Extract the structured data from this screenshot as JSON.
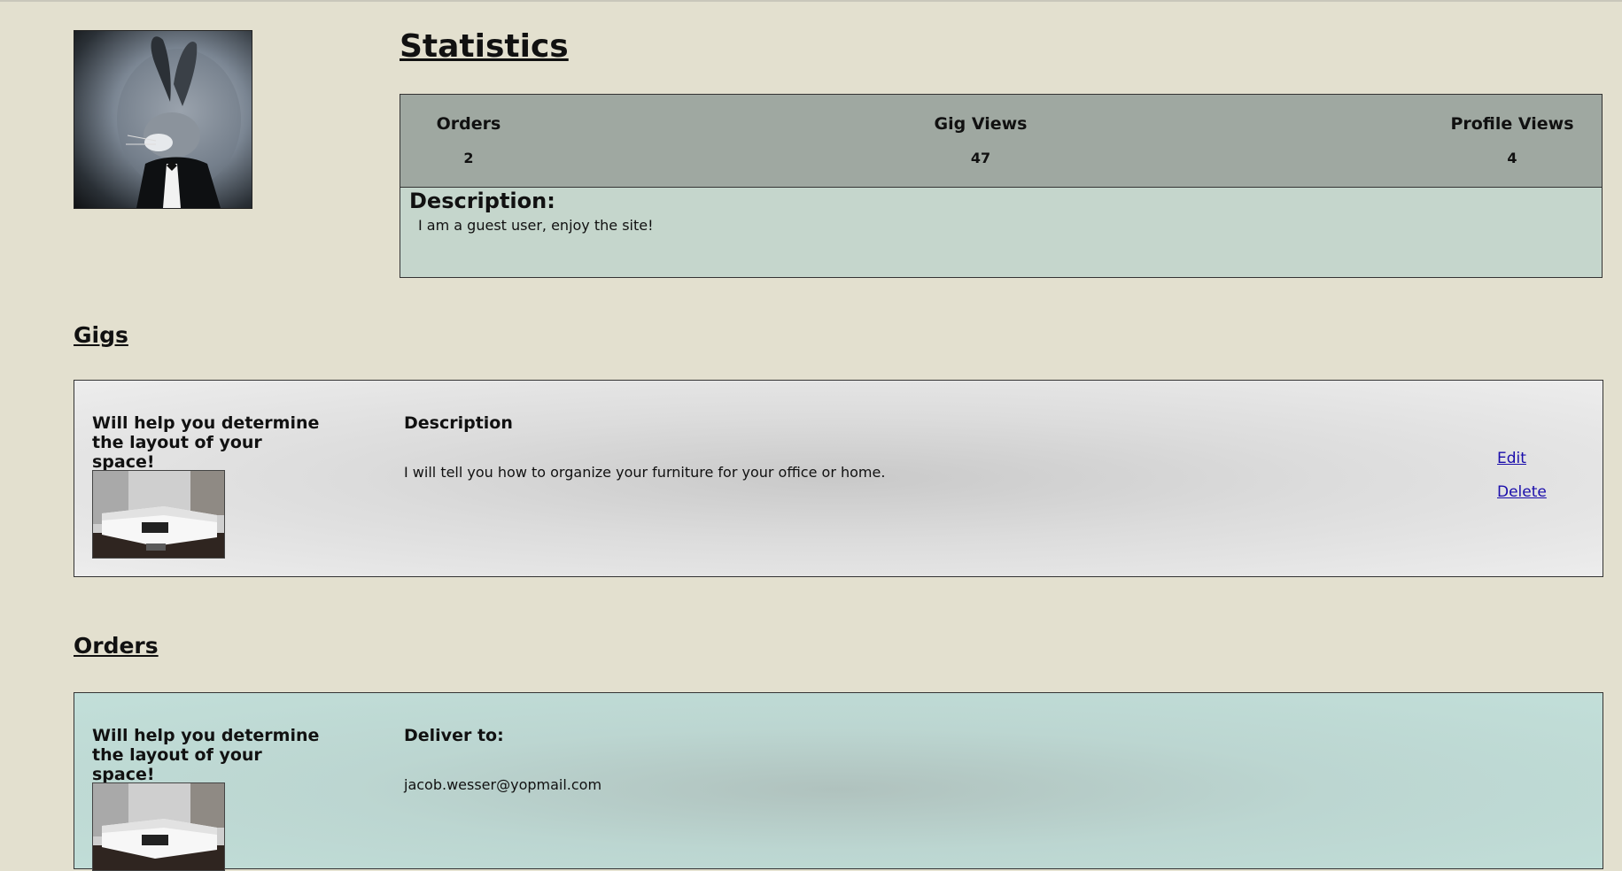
{
  "profile": {
    "avatar_icon": "rabbit-portrait"
  },
  "statistics": {
    "title": "Statistics",
    "orders_label": "Orders",
    "orders_value": "2",
    "gig_views_label": "Gig Views",
    "gig_views_value": "47",
    "profile_views_label": "Profile Views",
    "profile_views_value": "4",
    "description_label": "Description:",
    "description_text": "I am a guest user, enjoy the site!"
  },
  "gigs": {
    "title": "Gigs",
    "items": [
      {
        "title": "Will help you determine the layout of your space!",
        "image_icon": "sofa-photo",
        "description_label": "Description",
        "description_text": "I will tell you how to organize your furniture for your office or home.",
        "edit_label": "Edit",
        "delete_label": "Delete"
      }
    ]
  },
  "orders": {
    "title": "Orders",
    "items": [
      {
        "title": "Will help you determine the layout of your space!",
        "image_icon": "sofa-photo",
        "deliver_label": "Deliver to:",
        "deliver_email": "jacob.wesser@yopmail.com"
      }
    ]
  },
  "colors": {
    "page_bg": "#e3e0cf",
    "stats_header_bg": "#9fa8a1",
    "description_bg": "#c5d6cc",
    "order_card_bg": "#c2dfd9",
    "link": "#1a0dab"
  }
}
